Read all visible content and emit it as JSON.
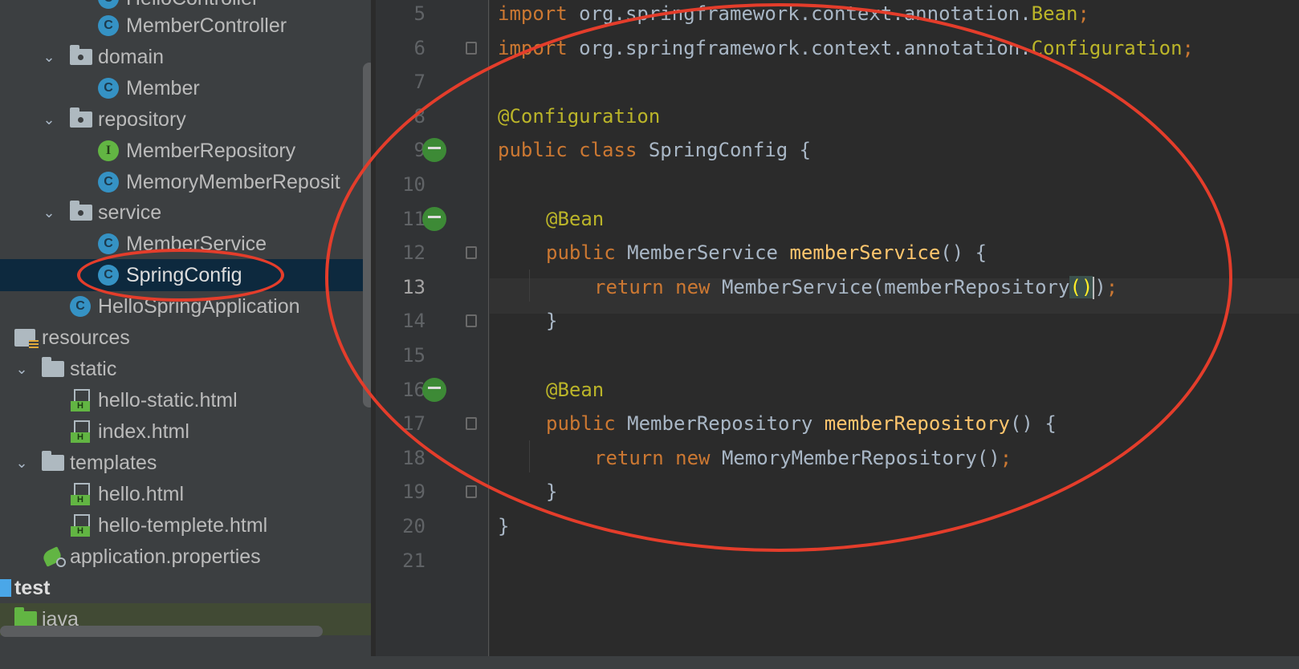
{
  "project_tree": {
    "items": [
      {
        "label": "HelloController",
        "type": "class"
      },
      {
        "label": "MemberController",
        "type": "class"
      },
      {
        "label": "domain",
        "type": "package"
      },
      {
        "label": "Member",
        "type": "class"
      },
      {
        "label": "repository",
        "type": "package"
      },
      {
        "label": "MemberRepository",
        "type": "interface"
      },
      {
        "label": "MemoryMemberReposit",
        "type": "class"
      },
      {
        "label": "service",
        "type": "package"
      },
      {
        "label": "MemberService",
        "type": "class"
      },
      {
        "label": "SpringConfig",
        "type": "class",
        "selected": true
      },
      {
        "label": "HelloSpringApplication",
        "type": "spring-class"
      },
      {
        "label": "resources",
        "type": "resources-folder"
      },
      {
        "label": "static",
        "type": "folder"
      },
      {
        "label": "hello-static.html",
        "type": "html"
      },
      {
        "label": "index.html",
        "type": "html"
      },
      {
        "label": "templates",
        "type": "folder"
      },
      {
        "label": "hello.html",
        "type": "html"
      },
      {
        "label": "hello-templete.html",
        "type": "html"
      },
      {
        "label": "application.properties",
        "type": "properties"
      },
      {
        "label": "test",
        "type": "test-folder"
      },
      {
        "label": "java",
        "type": "java-folder"
      }
    ]
  },
  "editor": {
    "line_numbers": [
      "5",
      "6",
      "7",
      "8",
      "9",
      "10",
      "11",
      "12",
      "13",
      "14",
      "15",
      "16",
      "17",
      "18",
      "19",
      "20",
      "21"
    ],
    "current_line": "13",
    "code": {
      "l5": {
        "kw": "import",
        "pkg": " org.springframework.context.annotation.",
        "cls": "Bean",
        "end": ";"
      },
      "l6": {
        "kw": "import",
        "pkg": " org.springframework.context.annotation.",
        "cls": "Configuration",
        "end": ";"
      },
      "l8": {
        "ann": "@Configuration"
      },
      "l9": {
        "kw": "public class",
        "name": " SpringConfig {"
      },
      "l11": {
        "ann": "@Bean"
      },
      "l12": {
        "kw": "public",
        "type": " MemberService ",
        "fn": "memberService",
        "rest": "() {"
      },
      "l13": {
        "kw": "return new",
        "type": " MemberService(memberRepository",
        "paren": "()",
        "after": ")",
        "end": ";"
      },
      "l14": {
        "text": "}"
      },
      "l16": {
        "ann": "@Bean"
      },
      "l17": {
        "kw": "public",
        "type": " MemberRepository ",
        "fn": "memberRepository",
        "rest": "() {"
      },
      "l18": {
        "kw": "return new",
        "type": " MemoryMemberRepository()",
        "end": ";"
      },
      "l19": {
        "text": "}"
      },
      "l20": {
        "text": "}"
      }
    }
  },
  "colors": {
    "annotation_circle": "#e43d2b",
    "selection": "#0d293e",
    "keyword": "#cc7832",
    "annotation": "#bbb529",
    "method": "#ffc66d"
  }
}
